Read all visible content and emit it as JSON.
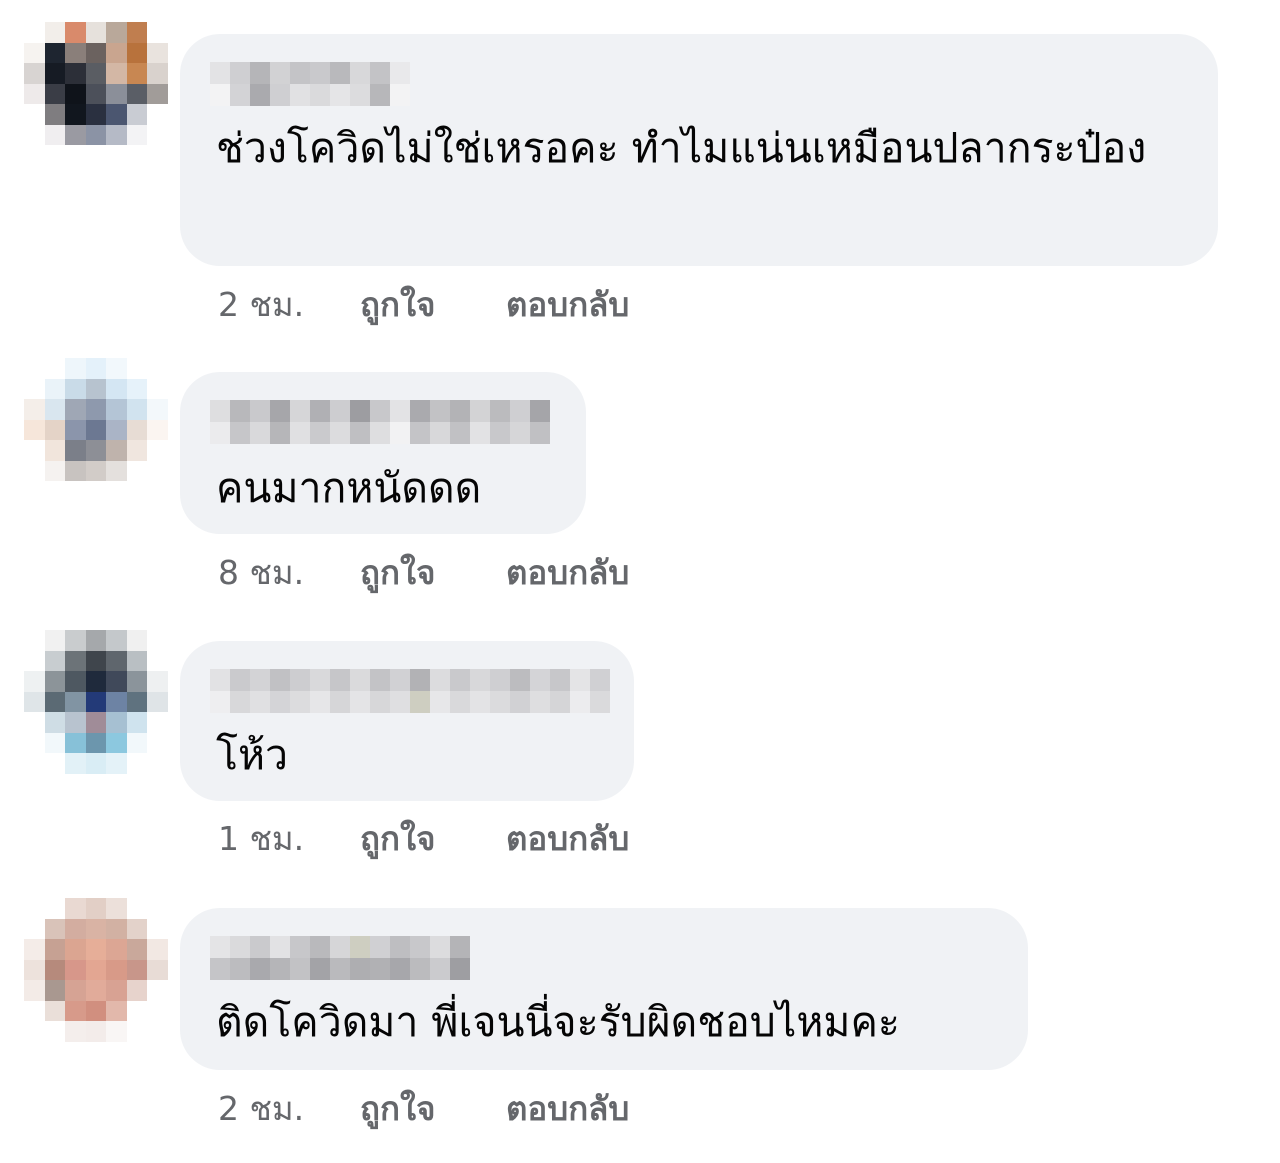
{
  "comments": [
    {
      "text": "ช่วงโควิดไม่ใช่เหรอคะ ทำไมแน่นเหมือนปลากระป๋อง",
      "time": "2 ชม.",
      "like_label": "ถูกใจ",
      "reply_label": "ตอบกลับ"
    },
    {
      "text": "คนมากหนัดดด",
      "time": "8 ชม.",
      "like_label": "ถูกใจ",
      "reply_label": "ตอบกลับ"
    },
    {
      "text": "โห้ว",
      "time": "1 ชม.",
      "like_label": "ถูกใจ",
      "reply_label": "ตอบกลับ"
    },
    {
      "text": "ติดโควิดมา พี่เจนนี่จะรับผิดชอบไหมคะ",
      "time": "2 ชม.",
      "like_label": "ถูกใจ",
      "reply_label": "ตอบกลับ"
    }
  ],
  "colors": {
    "bubble": "#f0f2f5",
    "text": "#050505",
    "meta": "#65676b"
  }
}
